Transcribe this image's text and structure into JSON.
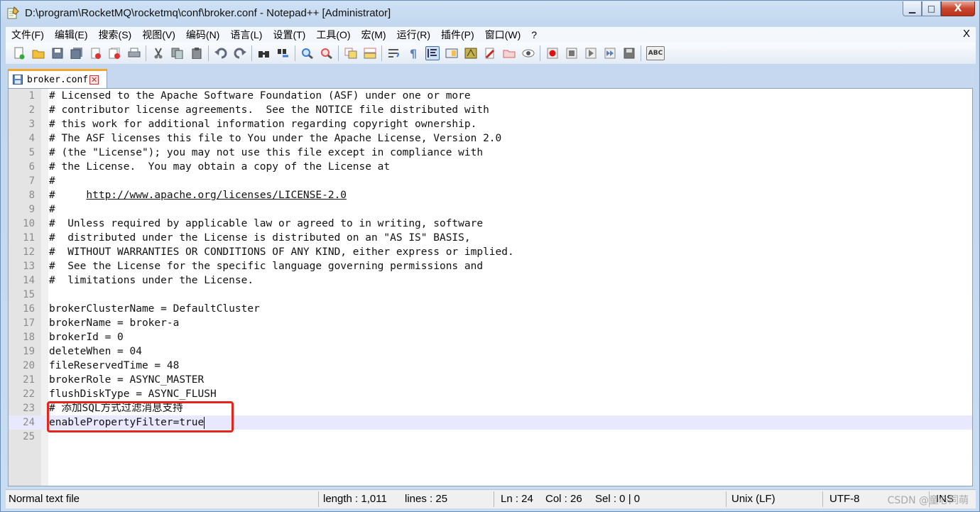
{
  "window": {
    "title": "D:\\program\\RocketMQ\\rocketmq\\conf\\broker.conf - Notepad++ [Administrator]",
    "minimize": "▁",
    "maximize": "□",
    "close": "X"
  },
  "menu": [
    "文件(F)",
    "编辑(E)",
    "搜索(S)",
    "视图(V)",
    "编码(N)",
    "语言(L)",
    "设置(T)",
    "工具(O)",
    "宏(M)",
    "运行(R)",
    "插件(P)",
    "窗口(W)",
    "?"
  ],
  "menu_close": "X",
  "tab": {
    "label": "broker.conf",
    "close": "✕"
  },
  "editor": {
    "lines": [
      "# Licensed to the Apache Software Foundation (ASF) under one or more",
      "# contributor license agreements.  See the NOTICE file distributed with",
      "# this work for additional information regarding copyright ownership.",
      "# The ASF licenses this file to You under the Apache License, Version 2.0",
      "# (the \"License\"); you may not use this file except in compliance with",
      "# the License.  You may obtain a copy of the License at",
      "#",
      "#     http://www.apache.org/licenses/LICENSE-2.0",
      "#",
      "#  Unless required by applicable law or agreed to in writing, software",
      "#  distributed under the License is distributed on an \"AS IS\" BASIS,",
      "#  WITHOUT WARRANTIES OR CONDITIONS OF ANY KIND, either express or implied.",
      "#  See the License for the specific language governing permissions and",
      "#  limitations under the License.",
      "",
      "brokerClusterName = DefaultCluster",
      "brokerName = broker-a",
      "brokerId = 0",
      "deleteWhen = 04",
      "fileReservedTime = 48",
      "brokerRole = ASYNC_MASTER",
      "flushDiskType = ASYNC_FLUSH",
      "# 添加SQL方式过滤消息支持",
      "enablePropertyFilter=true",
      ""
    ],
    "link_line": 8,
    "current_line": 24
  },
  "status": {
    "file_type": "Normal text file",
    "length": "length : 1,011",
    "lines": "lines : 25",
    "ln": "Ln : 24",
    "col": "Col : 26",
    "sel": "Sel : 0 | 0",
    "eol": "Unix (LF)",
    "encoding": "UTF-8",
    "mode": "INS",
    "watermark": "CSDN @童心同萌"
  },
  "toolbar_icons": [
    "new-file-icon",
    "open-file-icon",
    "save-icon",
    "save-all-icon",
    "close-icon",
    "close-all-icon",
    "print-icon",
    "cut-icon",
    "copy-icon",
    "paste-icon",
    "undo-icon",
    "redo-icon",
    "find-icon",
    "replace-icon",
    "zoom-in-icon",
    "zoom-out-icon",
    "sync-v-icon",
    "sync-h-icon",
    "wrap-icon",
    "show-all-chars-icon",
    "indent-guide-icon",
    "doc-map-icon",
    "function-list-icon",
    "folder-workspace-icon",
    "monitor-icon",
    "record-macro-icon",
    "stop-macro-icon",
    "play-macro-icon",
    "run-macro-multiple-icon",
    "save-macro-icon",
    "spellcheck-icon"
  ],
  "toolbar_spellcheck_label": "ABC"
}
